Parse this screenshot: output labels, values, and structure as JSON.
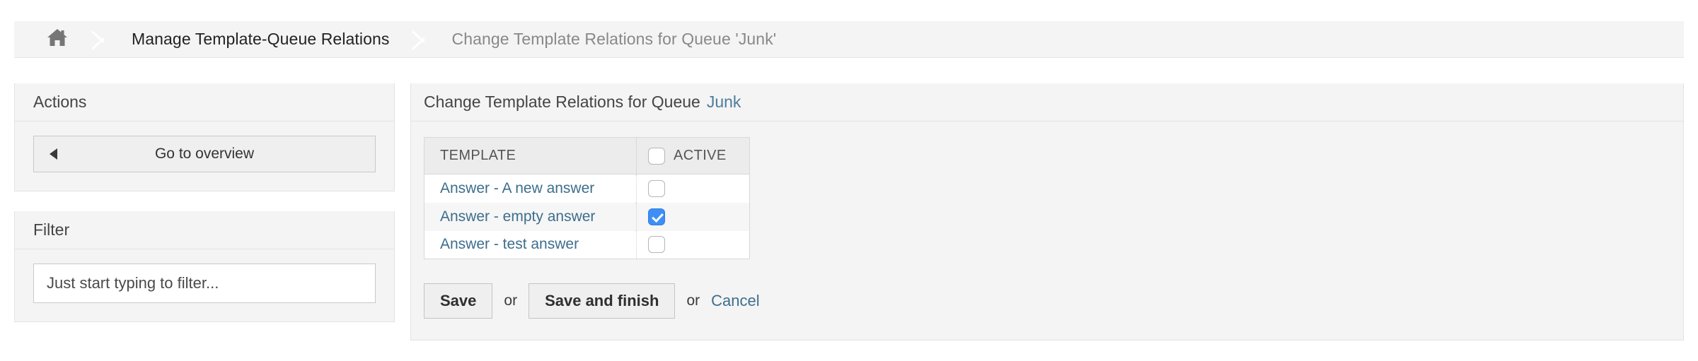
{
  "breadcrumb": {
    "home_icon": "home-icon",
    "items": [
      {
        "label": "Manage Template-Queue Relations",
        "muted": false
      },
      {
        "label": "Change Template Relations for Queue 'Junk'",
        "muted": true
      }
    ]
  },
  "sidebar": {
    "actions": {
      "title": "Actions",
      "go_to_overview_label": "Go to overview",
      "go_to_overview_icon": "arrow-left-icon"
    },
    "filter": {
      "title": "Filter",
      "input_value": "",
      "input_placeholder": "Just start typing to filter..."
    }
  },
  "main": {
    "header_prefix": "Change Template Relations for Queue",
    "header_queue": "Junk",
    "table": {
      "columns": [
        {
          "key": "template",
          "label": "TEMPLATE"
        },
        {
          "key": "active",
          "label": "ACTIVE"
        }
      ],
      "select_all_checked": false,
      "rows": [
        {
          "template": "Answer - A new answer",
          "active": false
        },
        {
          "template": "Answer - empty answer",
          "active": true
        },
        {
          "template": "Answer - test answer",
          "active": false
        }
      ]
    },
    "actions": {
      "save_label": "Save",
      "or_1": "or",
      "save_and_finish_label": "Save and finish",
      "or_2": "or",
      "cancel_label": "Cancel"
    }
  },
  "colors": {
    "link": "#3d6e8c",
    "checkbox_checked": "#3e8ef7",
    "panel_bg": "#f4f4f4",
    "panel_border": "#e3e3e3"
  }
}
